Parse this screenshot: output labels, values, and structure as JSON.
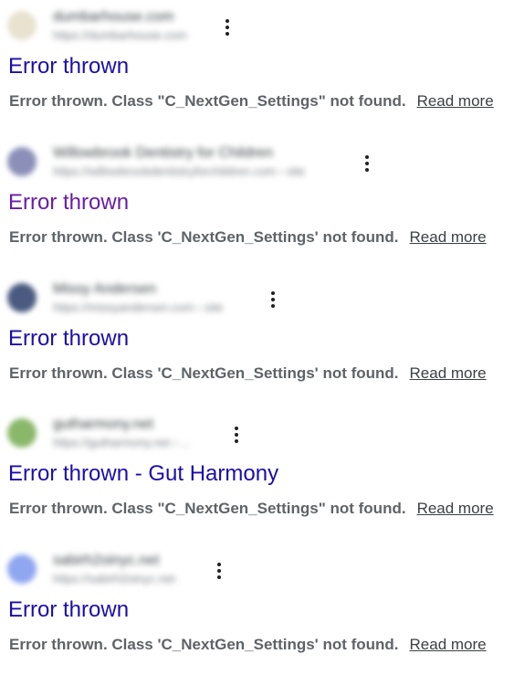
{
  "results": [
    {
      "site_name": "dumbarhouse.com",
      "site_url": "https://dumbarhouse.com",
      "title": "Error thrown",
      "snippet": "Error thrown. Class \"C_NextGen_Settings\" not found.",
      "read_more": "Read more",
      "favicon_color": "#e8e2cf"
    },
    {
      "site_name": "Willowbrook Dentistry for Children",
      "site_url": "https://willowbrookdentistryforchildren.com › site",
      "title": "Error thrown",
      "snippet": "Error thrown. Class 'C_NextGen_Settings' not found.",
      "read_more": "Read more",
      "favicon_color": "#8c90b8"
    },
    {
      "site_name": "Missy Andersen",
      "site_url": "https://missyandersen.com › site",
      "title": "Error thrown",
      "snippet": "Error thrown. Class 'C_NextGen_Settings' not found.",
      "read_more": "Read more",
      "favicon_color": "#4a5a80"
    },
    {
      "site_name": "gutharmony.net",
      "site_url": "https://gutharmony.net › ...",
      "title": "Error thrown - Gut Harmony",
      "snippet": "Error thrown. Class \"C_NextGen_Settings\" not found.",
      "read_more": "Read more",
      "favicon_color": "#8ab86a"
    },
    {
      "site_name": "sabirh2oinyc.net",
      "site_url": "https://sabirh2oinyc.net",
      "title": "Error thrown",
      "snippet": "Error thrown. Class 'C_NextGen_Settings' not found.",
      "read_more": "Read more",
      "favicon_color": "#8fa6f0"
    }
  ],
  "colors": {
    "link": "#1a0dab",
    "visited_link": "#681da8",
    "snippet": "#5f6368"
  }
}
